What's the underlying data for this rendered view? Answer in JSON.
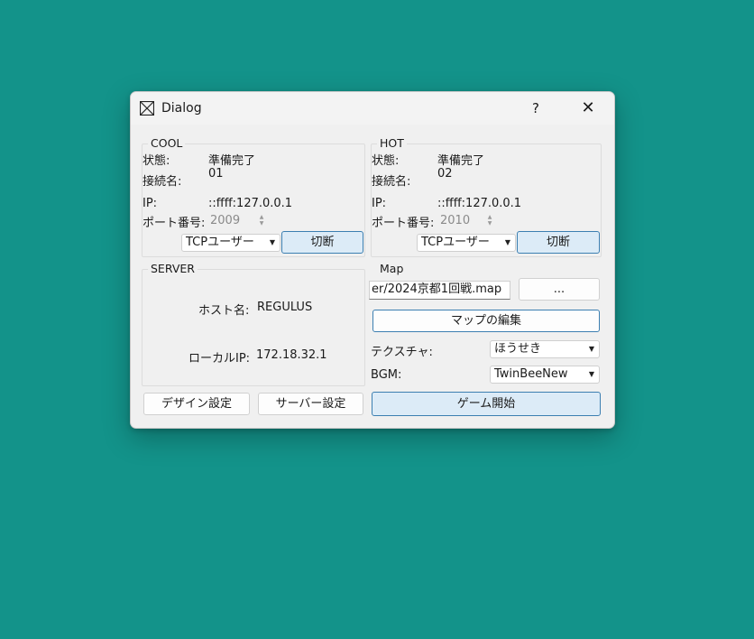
{
  "window": {
    "title": "Dialog",
    "help_label": "?",
    "close_label": "✕"
  },
  "cool": {
    "title": "COOL",
    "status_label": "状態:",
    "status_value": "準備完了",
    "conn_label": "接続名:",
    "conn_value": "01",
    "ip_label": "IP:",
    "ip_value": "::ffff:127.0.0.1",
    "port_label": "ポート番号:",
    "port_value": "2009",
    "mode_value": "TCPユーザー",
    "disconnect_label": "切断"
  },
  "hot": {
    "title": "HOT",
    "status_label": "状態:",
    "status_value": "準備完了",
    "conn_label": "接続名:",
    "conn_value": "02",
    "ip_label": "IP:",
    "ip_value": "::ffff:127.0.0.1",
    "port_label": "ポート番号:",
    "port_value": "2010",
    "mode_value": "TCPユーザー",
    "disconnect_label": "切断"
  },
  "server": {
    "title": "SERVER",
    "host_label": "ホスト名:",
    "host_value": "REGULUS",
    "local_ip_label": "ローカルIP:",
    "local_ip_value": "172.18.32.1"
  },
  "map": {
    "title": "Map",
    "path_value": "er/2024京都1回戦.map",
    "browse_label": "...",
    "edit_label": "マップの編集",
    "texture_label": "テクスチャ:",
    "texture_value": "ほうせき",
    "bgm_label": "BGM:",
    "bgm_value": "TwinBeeNew"
  },
  "footer": {
    "design_label": "デザイン設定",
    "server_settings_label": "サーバー設定",
    "start_label": "ゲーム開始"
  }
}
